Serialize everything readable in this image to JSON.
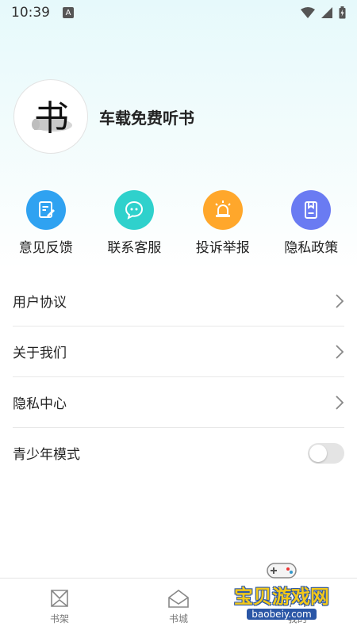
{
  "status_bar": {
    "time": "10:39",
    "notification_icon": "a-icon"
  },
  "profile": {
    "app_name": "车载免费听书",
    "avatar_glyph": "书"
  },
  "quick_actions": [
    {
      "label": "意见反馈",
      "icon": "feedback-icon",
      "color": "#2fa2f1"
    },
    {
      "label": "联系客服",
      "icon": "chat-icon",
      "color": "#2fd1cc"
    },
    {
      "label": "投诉举报",
      "icon": "alarm-icon",
      "color": "#ffa72b"
    },
    {
      "label": "隐私政策",
      "icon": "document-icon",
      "color": "#6a7bf2"
    }
  ],
  "menu": {
    "items": [
      {
        "label": "用户协议"
      },
      {
        "label": "关于我们"
      },
      {
        "label": "隐私中心"
      }
    ],
    "youth_mode": {
      "label": "青少年模式",
      "enabled": false
    }
  },
  "bottom_nav": {
    "items": [
      {
        "label": "书架",
        "icon": "bookshelf-icon"
      },
      {
        "label": "书城",
        "icon": "bookstore-icon"
      },
      {
        "label": "我的",
        "icon": "profile-icon"
      }
    ]
  },
  "watermark": {
    "text": "宝贝游戏网",
    "url": "baobeiy.com"
  }
}
